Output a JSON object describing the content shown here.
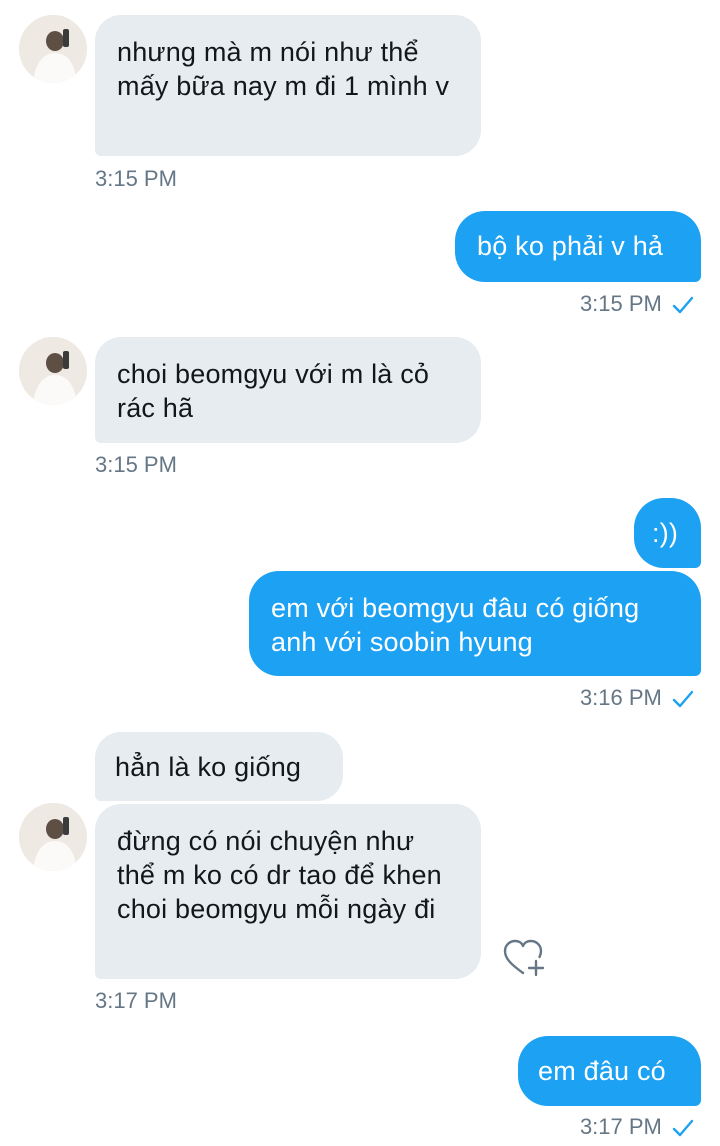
{
  "messages": [
    {
      "text": "nhưng mà m nói như thể mấy bữa nay m đi 1 mình v"
    },
    {
      "text": "bộ ko phải v hả"
    },
    {
      "text": "choi beomgyu với m là cỏ rác hã"
    },
    {
      "text": ":))"
    },
    {
      "text": "em với beomgyu đâu có giống anh với soobin hyung"
    },
    {
      "text": "hẳn là ko giống"
    },
    {
      "text": "đừng có nói chuyện như thể m ko có dr tao để khen choi beomgyu mỗi ngày đi"
    },
    {
      "text": "em đâu có"
    }
  ],
  "timestamps": {
    "t1": "3:15 PM",
    "t2": "3:15 PM",
    "t3": "3:15 PM",
    "t4": "3:16 PM",
    "t5": "3:17 PM",
    "t6": "3:17 PM"
  },
  "colors": {
    "outgoing_bubble": "#1da1f2",
    "incoming_bubble": "#e6ecf0",
    "timestamp": "#657786",
    "read_check": "#1da1f2"
  },
  "icons": {
    "read_receipt": "checkmark-icon",
    "like": "heart-plus-icon",
    "avatar": "avatar"
  }
}
